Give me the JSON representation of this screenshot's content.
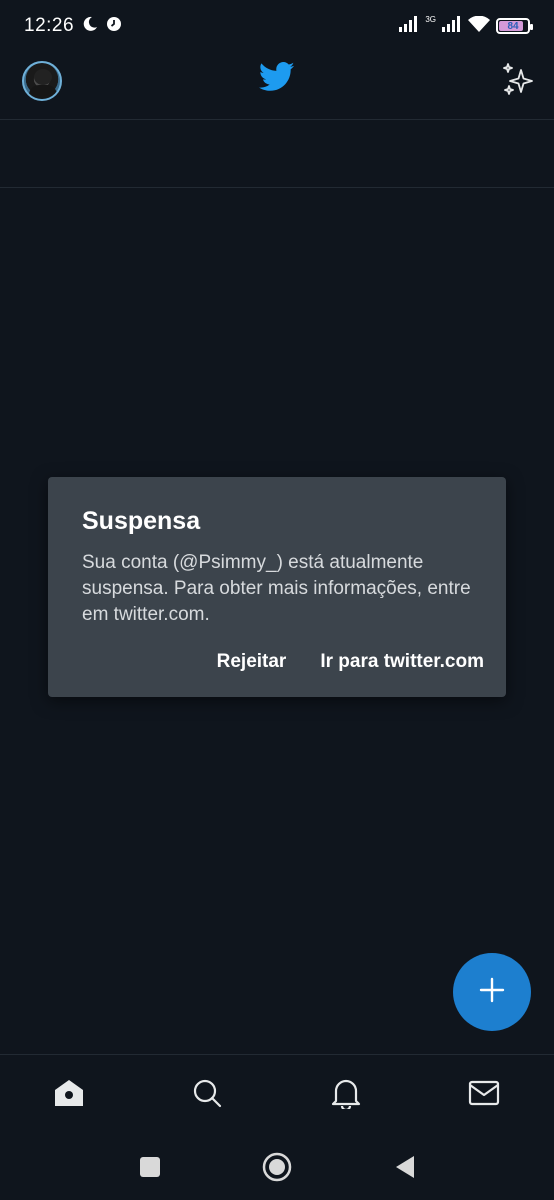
{
  "status_bar": {
    "time": "12:26",
    "network_type": "3G",
    "battery_level": "84",
    "battery_fraction": 0.84,
    "icons": [
      "moon-icon",
      "clock-icon",
      "signal-icon",
      "signal-icon-2",
      "wifi-icon",
      "battery-icon"
    ]
  },
  "header": {
    "avatar": "profile-avatar",
    "logo": "twitter-bird-icon",
    "sparkle": "sparkle-icon"
  },
  "dialog": {
    "title": "Suspensa",
    "body": "Sua conta (@Psimmy_) está atualmente suspensa. Para obter mais informações, entre em twitter.com.",
    "reject_label": "Rejeitar",
    "go_label": "Ir para twitter.com"
  },
  "fab": {
    "icon": "plus-icon"
  },
  "bottom_nav": {
    "items": [
      "home-icon",
      "search-icon",
      "notifications-icon",
      "messages-icon"
    ]
  },
  "system_nav": {
    "items": [
      "recents-icon",
      "home-circle-icon",
      "back-icon"
    ]
  },
  "colors": {
    "background": "#0f151d",
    "dialog": "#3c444c",
    "accent": "#1d9bf0",
    "fab": "#1d7fcf"
  }
}
